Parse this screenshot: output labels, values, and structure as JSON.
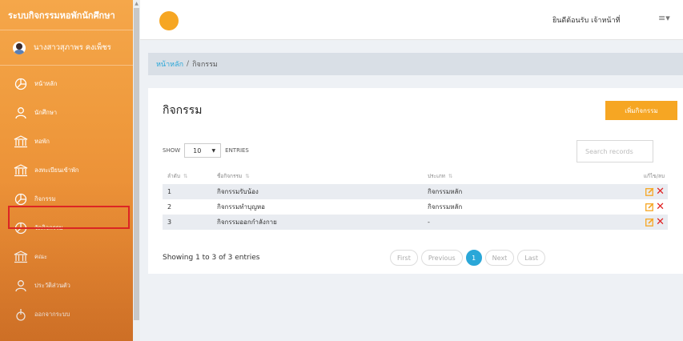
{
  "app": {
    "title": "ระบบกิจกรรมหอพักนักศึกษา"
  },
  "user": {
    "name": "นางสาวสุภาพร คงเพ็ชร"
  },
  "sidebar": {
    "items": [
      {
        "label": "หน้าหลัก",
        "icon": "pie-chart-icon"
      },
      {
        "label": "นักศึกษา",
        "icon": "user-icon"
      },
      {
        "label": "หอพัก",
        "icon": "building-icon"
      },
      {
        "label": "ลงทะเบียนเข้าพัก",
        "icon": "building-icon"
      },
      {
        "label": "กิจกรรม",
        "icon": "pie-chart-icon"
      },
      {
        "label": "จัดกิจกรรม",
        "icon": "pie-chart-icon"
      },
      {
        "label": "คณะ",
        "icon": "building-icon"
      },
      {
        "label": "ประวัติส่วนตัว",
        "icon": "user-icon"
      },
      {
        "label": "ออกจากระบบ",
        "icon": "logout-icon"
      }
    ]
  },
  "topbar": {
    "welcome": "ยินดีต้อนรับ เจ้าหน้าที่",
    "menu_icon": "≡▾"
  },
  "breadcrumb": {
    "home": "หน้าหลัก",
    "sep": "/",
    "current": "กิจกรรม"
  },
  "card": {
    "title": "กิจกรรม",
    "add_button": "เพิ่มกิจกรรม"
  },
  "table_controls": {
    "show": "SHOW",
    "entries_value": "10",
    "entries": "ENTRIES",
    "search_placeholder": "Search records"
  },
  "table": {
    "headers": [
      "ลำดับ",
      "ชื่อกิจกรรม",
      "ประเภท",
      "แก้ไข/ลบ"
    ],
    "rows": [
      {
        "no": "1",
        "name": "กิจกรรมรับน้อง",
        "type": "กิจกรรมหลัก"
      },
      {
        "no": "2",
        "name": "กิจกรรมทำบุญหอ",
        "type": "กิจกรรมหลัก"
      },
      {
        "no": "3",
        "name": "กิจกรรมออกกำลังกาย",
        "type": "-"
      }
    ]
  },
  "footer": {
    "showing": "Showing 1 to 3 of 3 entries"
  },
  "pager": {
    "first": "First",
    "previous": "Previous",
    "page": "1",
    "next": "Next",
    "last": "Last"
  },
  "colors": {
    "accent": "#f6a623",
    "link": "#2aa7d8",
    "delete": "#e02020",
    "highlight": "#e02424"
  }
}
